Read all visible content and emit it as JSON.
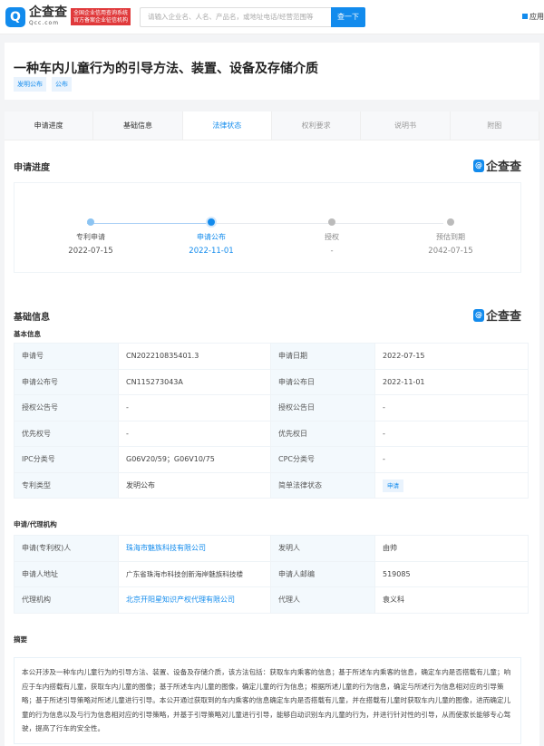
{
  "header": {
    "brand": "企查查",
    "brand_domain": "Qcc.com",
    "badge_line1": "全国企业信用查询系统",
    "badge_line2": "官方备案企业征信机构",
    "search_placeholder": "请输入企业名、人名、产品名，或地址电话/经营范围等",
    "search_button": "查一下",
    "app_label": "应用"
  },
  "patent": {
    "title": "一种车内儿童行为的引导方法、装置、设备及存储介质",
    "tags": [
      "发明公布",
      "公布"
    ]
  },
  "tabs": [
    {
      "label": "申请进度"
    },
    {
      "label": "基础信息"
    },
    {
      "label": "法律状态"
    },
    {
      "label": "权利要求"
    },
    {
      "label": "说明书"
    },
    {
      "label": "附图"
    }
  ],
  "progress": {
    "title": "申请进度",
    "logo": "企查查",
    "steps": [
      {
        "label": "专利申请",
        "date": "2022-07-15"
      },
      {
        "label": "申请公布",
        "date": "2022-11-01"
      },
      {
        "label": "授权",
        "date": "-"
      },
      {
        "label": "预估到期",
        "date": "2042-07-15"
      }
    ]
  },
  "basic": {
    "title": "基础信息",
    "logo": "企查查",
    "subtitle": "基本信息",
    "rows": [
      [
        "申请号",
        "CN202210835401.3",
        "申请日期",
        "2022-07-15"
      ],
      [
        "申请公布号",
        "CN115273043A",
        "申请公布日",
        "2022-11-01"
      ],
      [
        "授权公告号",
        "-",
        "授权公告日",
        "-"
      ],
      [
        "优先权号",
        "-",
        "优先权日",
        "-"
      ],
      [
        "IPC分类号",
        "G06V20/59；G06V10/75",
        "CPC分类号",
        "-"
      ],
      [
        "专利类型",
        "发明公布",
        "简单法律状态",
        "申请"
      ]
    ]
  },
  "org": {
    "title": "申请/代理机构",
    "rows": [
      [
        "申请(专利权)人",
        "珠海市魅族科技有限公司",
        "发明人",
        "由帅"
      ],
      [
        "申请人地址",
        "广东省珠海市科技创新海岸魅族科技楼",
        "申请人邮编",
        "519085"
      ],
      [
        "代理机构",
        "北京开阳星知识产权代理有限公司",
        "代理人",
        "袁义科"
      ]
    ]
  },
  "abstract": {
    "title": "摘要",
    "text": "本公开涉及一种车内儿童行为的引导方法、装置、设备及存储介质，该方法包括：获取车内乘客的信息；基于所述车内乘客的信息，确定车内是否搭载有儿童；响应于车内搭载有儿童，获取车内儿童的图像；基于所述车内儿童的图像，确定儿童的行为信息；根据所述儿童的行为信息，确定与所述行为信息相对应的引导策略；基于所述引导策略对所述儿童进行引导。本公开通过获取到的车内乘客的信息确定车内是否搭载有儿童，并在搭载有儿童时获取车内儿童的图像，进而确定儿童的行为信息以及与行为信息相对应的引导策略，并基于引导策略对儿童进行引导，能够自动识别车内儿童的行为，并进行针对性的引导，从而使家长能够专心驾驶，提高了行车的安全性。"
  }
}
